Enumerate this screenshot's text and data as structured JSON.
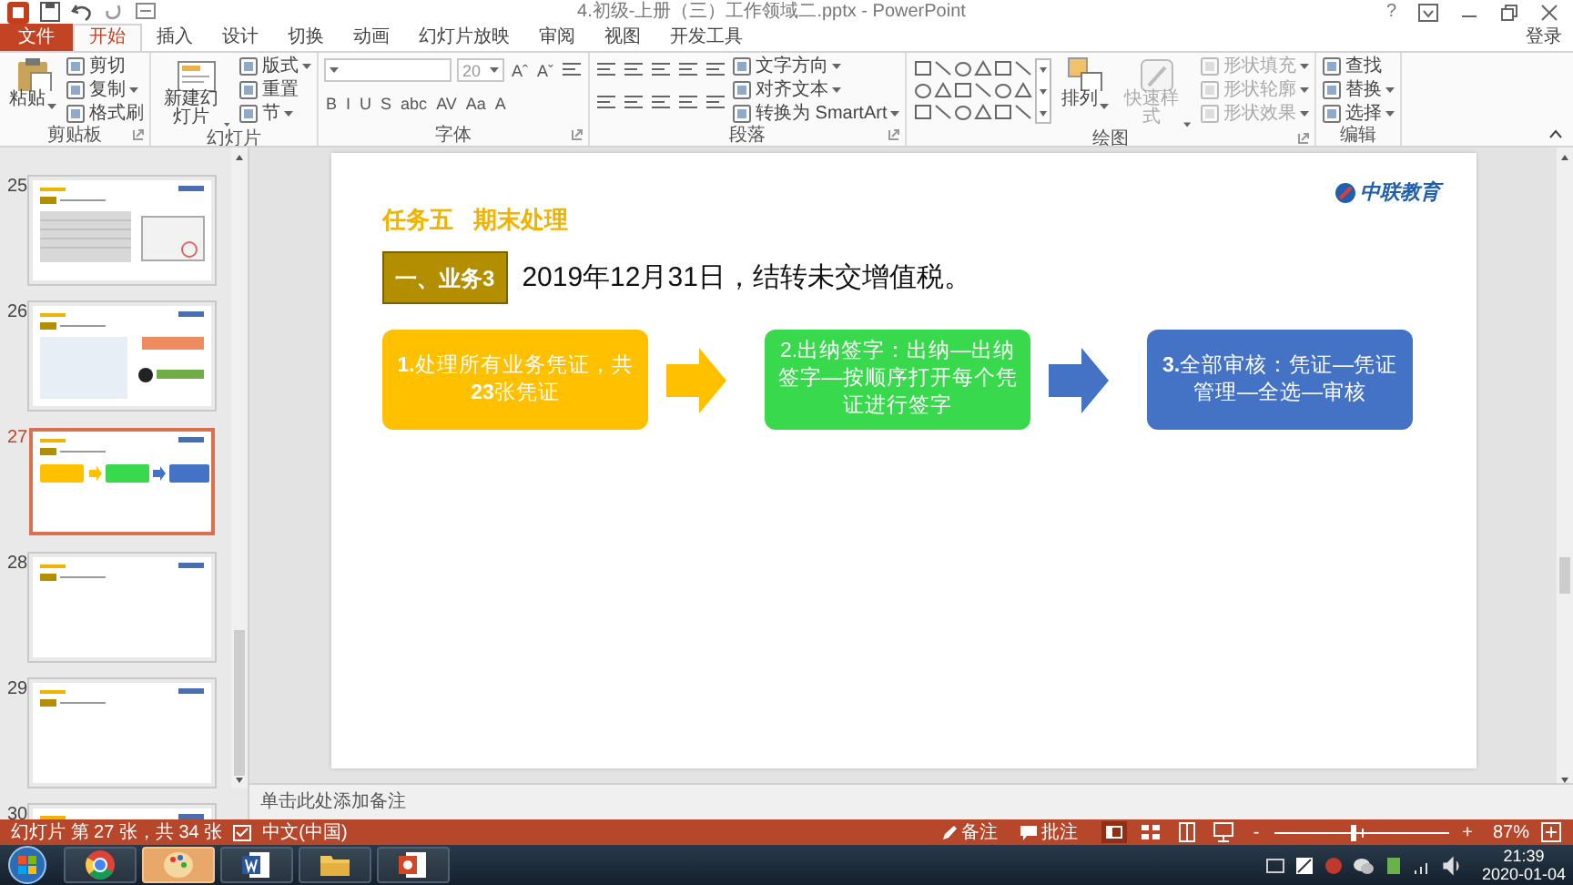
{
  "window": {
    "title": "4.初级-上册（三）工作领域二.pptx - PowerPoint",
    "help": "?"
  },
  "tabs": [
    {
      "label": "文件",
      "kind": "file",
      "selected": false
    },
    {
      "label": "开始",
      "kind": "tab",
      "selected": true
    },
    {
      "label": "插入",
      "kind": "tab",
      "selected": false
    },
    {
      "label": "设计",
      "kind": "tab",
      "selected": false
    },
    {
      "label": "切换",
      "kind": "tab",
      "selected": false
    },
    {
      "label": "动画",
      "kind": "tab",
      "selected": false
    },
    {
      "label": "幻灯片放映",
      "kind": "tab",
      "selected": false
    },
    {
      "label": "审阅",
      "kind": "tab",
      "selected": false
    },
    {
      "label": "视图",
      "kind": "tab",
      "selected": false
    },
    {
      "label": "开发工具",
      "kind": "tab",
      "selected": false
    }
  ],
  "account": "登录",
  "ribbon": [
    {
      "label": "剪贴板",
      "launcher": true,
      "items": [
        {
          "kind": "large",
          "label": "粘贴",
          "menu": true
        },
        {
          "kind": "stack",
          "rows": [
            {
              "cells": [
                {
                  "kind": "button",
                  "label": "剪切"
                }
              ]
            },
            {
              "cells": [
                {
                  "kind": "button",
                  "label": "复制",
                  "menu": true
                }
              ]
            },
            {
              "cells": [
                {
                  "kind": "button",
                  "label": "格式刷"
                }
              ]
            }
          ]
        }
      ]
    },
    {
      "label": "幻灯片",
      "items": [
        {
          "kind": "large",
          "label": "新建幻灯片",
          "menu": true
        },
        {
          "kind": "stack",
          "rows": [
            {
              "cells": [
                {
                  "kind": "button",
                  "label": "版式",
                  "menu": true
                }
              ]
            },
            {
              "cells": [
                {
                  "kind": "button",
                  "label": "重置"
                }
              ]
            },
            {
              "cells": [
                {
                  "kind": "button",
                  "label": "节",
                  "menu": true
                }
              ]
            }
          ]
        }
      ]
    },
    {
      "label": "字体",
      "launcher": true,
      "items": [
        {
          "kind": "bar",
          "cells": [
            {
              "kind": "field"
            },
            {
              "kind": "field",
              "value": "20"
            },
            {
              "kind": "glyph",
              "label": "Aˆ"
            },
            {
              "kind": "glyph",
              "label": "Aˇ"
            },
            {
              "kind": "lines"
            }
          ]
        },
        {
          "kind": "bar",
          "cells": [
            {
              "kind": "glyph",
              "label": "B"
            },
            {
              "kind": "glyph",
              "label": "I"
            },
            {
              "kind": "glyph",
              "label": "U"
            },
            {
              "kind": "glyph",
              "label": "S"
            },
            {
              "kind": "glyph",
              "label": "abc"
            },
            {
              "kind": "glyph",
              "label": "AV"
            },
            {
              "kind": "glyph",
              "label": "Aa"
            },
            {
              "kind": "glyph",
              "label": "A"
            }
          ]
        }
      ]
    },
    {
      "label": "段落",
      "launcher": true,
      "items": [
        {
          "kind": "stack",
          "rows": [
            {
              "cells": [
                {
                  "kind": "lines"
                },
                {
                  "kind": "lines"
                },
                {
                  "kind": "lines"
                },
                {
                  "kind": "lines"
                },
                {
                  "kind": "lines"
                }
              ]
            },
            {
              "cells": [
                {
                  "kind": "lines"
                },
                {
                  "kind": "lines"
                },
                {
                  "kind": "lines"
                },
                {
                  "kind": "lines"
                },
                {
                  "kind": "lines"
                }
              ]
            }
          ]
        },
        {
          "kind": "stack",
          "rows": [
            {
              "cells": [
                {
                  "kind": "button",
                  "label": "文字方向",
                  "menu": true
                }
              ]
            },
            {
              "cells": [
                {
                  "kind": "button",
                  "label": "对齐文本",
                  "menu": true
                }
              ]
            },
            {
              "cells": [
                {
                  "kind": "button",
                  "label": "转换为 SmartArt",
                  "menu": true
                }
              ]
            }
          ]
        }
      ]
    },
    {
      "label": "绘图",
      "launcher": true,
      "items": [
        {
          "kind": "gallery"
        },
        {
          "kind": "large",
          "label": "排列",
          "menu": true,
          "disabled": false
        },
        {
          "kind": "large",
          "label": "快速样式",
          "menu": true,
          "disabled": true
        },
        {
          "kind": "stack",
          "rows": [
            {
              "cells": [
                {
                  "kind": "button",
                  "label": "形状填充",
                  "menu": true,
                  "disabled": true
                }
              ]
            },
            {
              "cells": [
                {
                  "kind": "button",
                  "label": "形状轮廓",
                  "menu": true,
                  "disabled": true
                }
              ]
            },
            {
              "cells": [
                {
                  "kind": "button",
                  "label": "形状效果",
                  "menu": true,
                  "disabled": true
                }
              ]
            }
          ]
        }
      ]
    },
    {
      "label": "编辑",
      "items": [
        {
          "kind": "stack",
          "rows": [
            {
              "cells": [
                {
                  "kind": "button",
                  "label": "查找"
                }
              ]
            },
            {
              "cells": [
                {
                  "kind": "button",
                  "label": "替换",
                  "menu": true
                }
              ]
            },
            {
              "cells": [
                {
                  "kind": "button",
                  "label": "选择",
                  "menu": true
                }
              ]
            }
          ]
        }
      ]
    }
  ],
  "thumbnails": [
    {
      "number": "25",
      "kind": "table",
      "selected": false
    },
    {
      "number": "26",
      "kind": "form",
      "selected": false
    },
    {
      "number": "27",
      "kind": "flow",
      "selected": true
    },
    {
      "number": "28",
      "kind": "text",
      "selected": false
    },
    {
      "number": "29",
      "kind": "text",
      "selected": false
    },
    {
      "number": "30",
      "kind": "text",
      "selected": false
    }
  ],
  "slide": {
    "heading": "任务五   期末处理",
    "logo": "中联教育",
    "tag": "一、业务3",
    "statement": "2019年12月31日，结转未交增值税。",
    "steps": [
      {
        "text": "**1.**处理所有业务凭证，共**23**张凭证",
        "color": "#ffc000"
      },
      {
        "text": "2.出纳签字：出纳—出纳签字—按顺序打开每个凭证进行签字",
        "color": "#38d94c"
      },
      {
        "text": "**3.**全部审核：凭证—凭证管理—全选—审核",
        "color": "#4472c4"
      }
    ],
    "arrows": [
      {
        "color": "#ffc000"
      },
      {
        "color": "#4472c4"
      }
    ]
  },
  "notes": {
    "placeholder": "单击此处添加备注"
  },
  "status_bar": {
    "slide_info": "幻灯片 第 27 张，共 34 张",
    "language": "中文(中国)",
    "notes": "备注",
    "comments": "批注",
    "zoom": {
      "minus": "-",
      "plus": "+",
      "level": 0.45,
      "reading": "87%"
    }
  },
  "taskbar": {
    "apps": [
      {
        "kind": "browser",
        "selected": false
      },
      {
        "kind": "paint",
        "selected": true
      },
      {
        "kind": "word",
        "selected": false
      },
      {
        "kind": "folder",
        "selected": false
      },
      {
        "kind": "slides",
        "selected": false
      }
    ],
    "time": "21:39",
    "date": "2020-01-04"
  }
}
